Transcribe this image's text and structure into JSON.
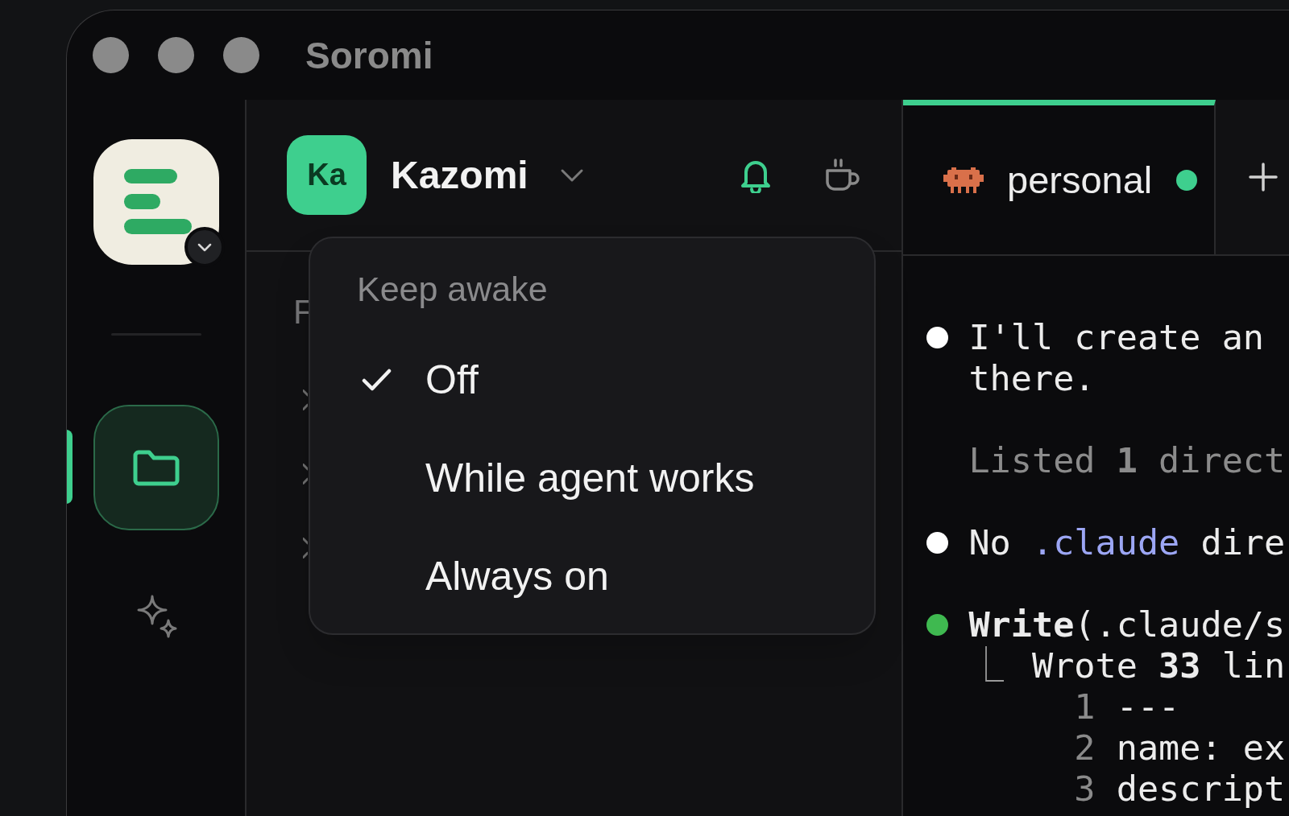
{
  "window": {
    "title": "Soromi"
  },
  "sidebar": {
    "items": [
      {
        "kind": "folder",
        "selected": true
      },
      {
        "kind": "sparkle",
        "selected": false
      }
    ]
  },
  "workspace": {
    "avatar": "Ka",
    "name": "Kazomi",
    "notifications": {
      "on": true
    }
  },
  "panel": {
    "label": "F",
    "rows": [
      {
        "expanded": false
      },
      {
        "expanded": false
      },
      {
        "expanded": false
      }
    ]
  },
  "keep_awake_menu": {
    "title": "Keep awake",
    "options": [
      {
        "label": "Off",
        "selected": true
      },
      {
        "label": "While agent works",
        "selected": false
      },
      {
        "label": "Always on",
        "selected": false
      }
    ]
  },
  "tabs": [
    {
      "label": "personal",
      "selected": true,
      "color": "#3ecf8e"
    }
  ],
  "terminal": {
    "blocks": [
      {
        "kind": "message",
        "color": "#ffffff",
        "lines": [
          [
            {
              "kind": "plain",
              "text": "I'll create an"
            }
          ],
          [
            {
              "kind": "plain",
              "text": "there."
            }
          ]
        ]
      },
      {
        "kind": "detail",
        "lines": [
          [
            {
              "kind": "plain",
              "text": "Listed **1** direct"
            }
          ]
        ]
      },
      {
        "kind": "message",
        "color": "#ffffff",
        "lines": [
          [
            {
              "kind": "plain",
              "text": "No "
            },
            {
              "kind": "path",
              "text": ".claude"
            },
            {
              "kind": "plain",
              "text": " dire"
            }
          ]
        ]
      },
      {
        "kind": "tool",
        "color": "#3fb950",
        "lines": [
          [
            {
              "kind": "plain",
              "text": "**Write**(.claude/s"
            }
          ]
        ],
        "output": {
          "marker": "⎿",
          "text": "Wrote **33** lin"
        },
        "code_lines": [
          {
            "number": "1",
            "text": "---"
          },
          {
            "number": "2",
            "text": "name: ex"
          },
          {
            "number": "3",
            "text": "descript"
          }
        ]
      }
    ]
  }
}
